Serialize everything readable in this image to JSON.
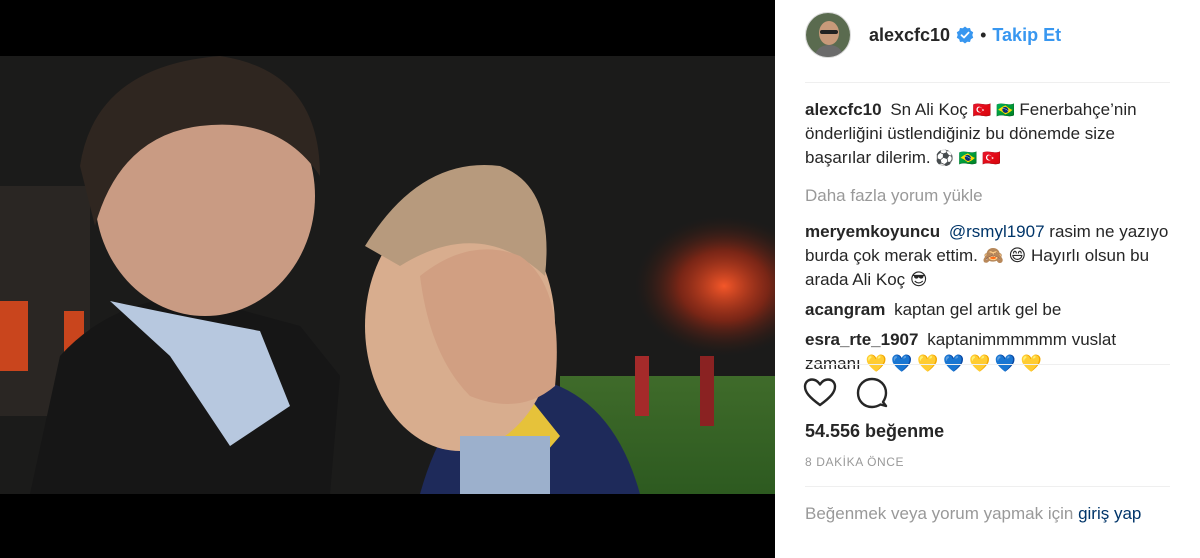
{
  "post": {
    "username": "alexcfc10",
    "verified_icon": "verified-badge-icon",
    "follow_label": "Takip Et",
    "separator": "•"
  },
  "caption": {
    "user": "alexcfc10",
    "text_1": "Sn Ali Koç",
    "text_2": "Fenerbahçe’nin önderliğini üstlendiğiniz bu dönemde size başarılar dilerim.",
    "emojis_1": "🇹🇷 🇧🇷",
    "emojis_2": "⚽ 🇧🇷 🇹🇷"
  },
  "load_more": "Daha fazla yorum yükle",
  "comments": [
    {
      "user": "meryemkoyuncu",
      "mention": "@rsmyl1907",
      "text": "rasim ne yazıyo burda çok merak ettim. 🙈 😄  Hayırlı olsun bu arada Ali Koç 😎"
    },
    {
      "user": "acangram",
      "mention": "",
      "text": "kaptan gel artık gel be"
    },
    {
      "user": "esra_rte_1907",
      "mention": "",
      "text": "kaptanimmmmmm vuslat zamanı 💛 💙 💛 💙 💛 💙 💛"
    }
  ],
  "likes": "54.556 beğenme",
  "timestamp": "8 DAKİKA ÖNCE",
  "login_prompt": {
    "text": "Beğenmek veya yorum yapmak için",
    "link": "giriş yap"
  },
  "colors": {
    "link_blue": "#3897f0",
    "mention": "#003569",
    "muted": "#999999"
  }
}
